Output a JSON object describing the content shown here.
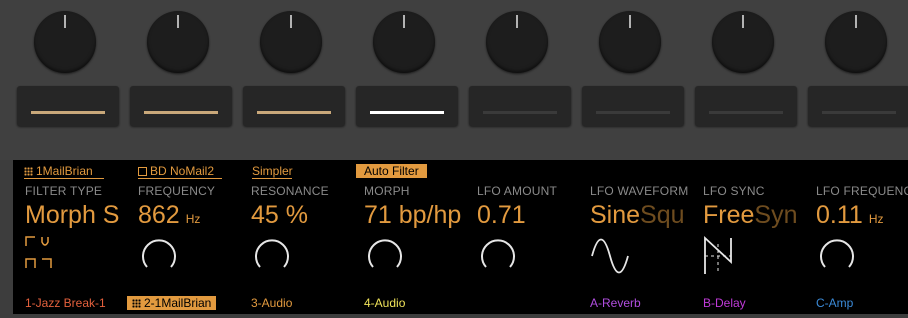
{
  "hardware": {
    "knob_count": 8,
    "buttons": [
      {
        "state": "amber"
      },
      {
        "state": "amber"
      },
      {
        "state": "amber"
      },
      {
        "state": "white"
      },
      {
        "state": "off"
      },
      {
        "state": "off"
      },
      {
        "state": "off"
      },
      {
        "state": "off"
      }
    ]
  },
  "top_bar": [
    {
      "label": "1MailBrian",
      "icon": "grid-icon"
    },
    {
      "label": "BD  NoMail2",
      "icon": "square-icon"
    },
    {
      "label": "Simpler"
    },
    {
      "label": "Auto Filter"
    }
  ],
  "params": [
    {
      "name": "FILTER TYPE",
      "value": "Morph S",
      "unit": ""
    },
    {
      "name": "FREQUENCY",
      "value": "862",
      "unit": "Hz"
    },
    {
      "name": "RESONANCE",
      "value": "45 %",
      "unit": ""
    },
    {
      "name": "MORPH",
      "value": "71 bp/hp",
      "unit": ""
    },
    {
      "name": "LFO AMOUNT",
      "value": "0.71",
      "unit": ""
    },
    {
      "name": "LFO WAVEFORM",
      "value": "Sine",
      "value_dim": "Squ",
      "unit": ""
    },
    {
      "name": "LFO SYNC",
      "value": "Free",
      "value_dim": "Syn",
      "unit": ""
    },
    {
      "name": "LFO FREQUENCY",
      "value": "0.11",
      "unit": "Hz"
    }
  ],
  "tracks": [
    {
      "label": "1-Jazz Break-1",
      "color": "#e5613d"
    },
    {
      "label": "2-1MailBrian",
      "color": "#e29a3f",
      "selected": true,
      "icon": "grid-icon"
    },
    {
      "label": "3-Audio",
      "color": "#e29a3f"
    },
    {
      "label": "4-Audio",
      "color": "#f0e35a"
    },
    {
      "label": "",
      "color": "#000000"
    },
    {
      "label": "A-Reverb",
      "color": "#b14ee0"
    },
    {
      "label": "B-Delay",
      "color": "#c03bd9"
    },
    {
      "label": "C-Amp",
      "color": "#3b8bd9"
    }
  ],
  "colors": {
    "accent": "#e29a3f",
    "label": "#8a8a8a",
    "screen_bg": "#000000"
  }
}
